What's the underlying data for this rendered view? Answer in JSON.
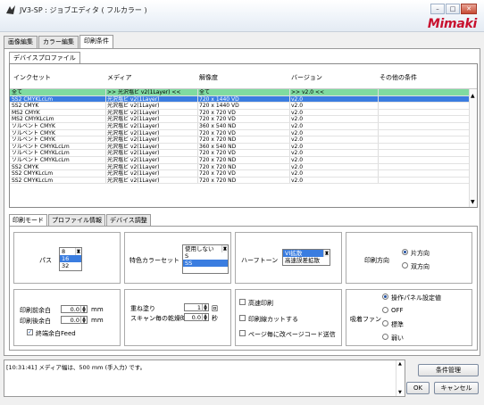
{
  "window": {
    "title": "JV3-SP : ジョブエディタ ( フルカラー )",
    "logo": "Mimaki",
    "btn_min": "–",
    "btn_max": "□",
    "btn_close": "✕"
  },
  "tabs": [
    "画像編集",
    "カラー編集",
    "印刷条件"
  ],
  "subtab": "デバイスプロファイル",
  "table": {
    "headers": [
      "インクセット",
      "メディア",
      "解像度",
      "バージョン",
      "その他の条件"
    ],
    "rows": [
      [
        "全て",
        ">> 光沢塩ビ v2(1Layer) <<",
        "全て",
        ">> v2.0 <<",
        ""
      ],
      [
        "SS2 CMYKLcLm",
        "光沢塩ビ v2(1Layer)",
        "720 x 1440 VD",
        "v2.0",
        ""
      ],
      [
        "SS2 CMYK",
        "光沢塩ビ v2(1Layer)",
        "720 x 1440 VD",
        "v2.0",
        ""
      ],
      [
        "MS2 CMYK",
        "光沢塩ビ v2(1Layer)",
        "720 x 720 VD",
        "v2.0",
        ""
      ],
      [
        "MS2 CMYKLcLm",
        "光沢塩ビ v2(1Layer)",
        "720 x 720 VD",
        "v2.0",
        ""
      ],
      [
        "ソルベント CMYK",
        "光沢塩ビ v2(1Layer)",
        "360 x 540 ND",
        "v2.0",
        ""
      ],
      [
        "ソルベント CMYK",
        "光沢塩ビ v2(1Layer)",
        "720 x 720 VD",
        "v2.0",
        ""
      ],
      [
        "ソルベント CMYK",
        "光沢塩ビ v2(1Layer)",
        "720 x 720 ND",
        "v2.0",
        ""
      ],
      [
        "ソルベント CMYKLcLm",
        "光沢塩ビ v2(1Layer)",
        "360 x 540 ND",
        "v2.0",
        ""
      ],
      [
        "ソルベント CMYKLcLm",
        "光沢塩ビ v2(1Layer)",
        "720 x 720 VD",
        "v2.0",
        ""
      ],
      [
        "ソルベント CMYKLcLm",
        "光沢塩ビ v2(1Layer)",
        "720 x 720 ND",
        "v2.0",
        ""
      ],
      [
        "SS2 CMYK",
        "光沢塩ビ v2(1Layer)",
        "720 x 720 ND",
        "v2.0",
        ""
      ],
      [
        "SS2 CMYKLcLm",
        "光沢塩ビ v2(1Layer)",
        "720 x 720 VD",
        "v2.0",
        ""
      ],
      [
        "SS2 CMYKLcLm",
        "光沢塩ビ v2(1Layer)",
        "720 x 720 ND",
        "v2.0",
        ""
      ]
    ]
  },
  "bottom_tabs": [
    "印刷モード",
    "プロファイル情報",
    "デバイス調整"
  ],
  "print_mode": {
    "pass_label": "パス",
    "pass_options": [
      "8",
      "16",
      "32"
    ],
    "pass_selected": "16",
    "special_color_label": "特色カラーセット",
    "special_color_options": [
      "使用しない",
      "S",
      "SS"
    ],
    "special_color_selected": "SS",
    "halftone_label": "ハーフトーン",
    "halftone_options": [
      "VI拡散",
      "高速誤差拡散"
    ],
    "halftone_selected": "VI拡散",
    "direction_label": "印刷方向",
    "direction_options": [
      "片方向",
      "双方向"
    ],
    "direction_selected": "片方向",
    "margin_front_label": "印刷前余白",
    "margin_front_value": "0.0",
    "margin_back_label": "印刷後余白",
    "margin_back_value": "0.0",
    "unit_mm": "mm",
    "white_feed_label": "終端余白Feed",
    "overprint_label": "重ね塗り",
    "overprint_value": "1",
    "overprint_unit": "回",
    "dry_label": "スキャン毎の乾燥時間",
    "dry_value": "0.0",
    "dry_unit": "秒",
    "highspeed_label": "高速印刷",
    "cutline_label": "印刷線カットする",
    "pagecode_label": "ページ毎に改ページコード送信",
    "fan_label": "吸着ファン",
    "fan_options": [
      "操作パネル設定値",
      "OFF",
      "標準",
      "弱い"
    ],
    "fan_selected": "操作パネル設定値"
  },
  "log": "[10:31:41] メディア幅は、500 mm (手入力) です。",
  "buttons": {
    "condition": "条件管理",
    "ok": "OK",
    "cancel": "キャンセル"
  }
}
